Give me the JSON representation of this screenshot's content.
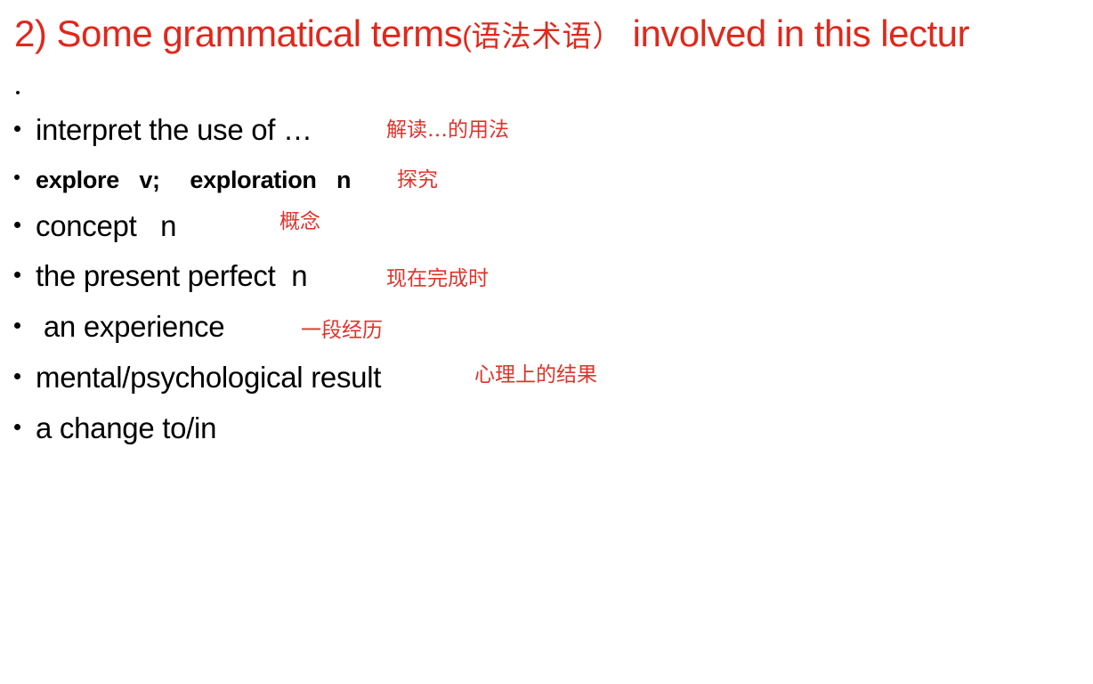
{
  "slide": {
    "title": {
      "prefix": "2) Some grammatical terms",
      "open_paren": "(",
      "chinese": "语法术语",
      "close_paren": "）",
      "suffix": " involved in this lectur"
    },
    "stray_mark": ".",
    "items": [
      {
        "term": "interpret the use of …",
        "gloss": "解读…的用法",
        "bold": false
      },
      {
        "term": "explore  v;   exploration  n",
        "gloss": "探究",
        "bold": true
      },
      {
        "term": "concept   n",
        "gloss": "概念",
        "bold": false
      },
      {
        "term": "the present perfect  n",
        "gloss": "现在完成时",
        "bold": false
      },
      {
        "term": " an experience",
        "gloss": "一段经历",
        "bold": false
      },
      {
        "term": "mental/psychological result",
        "gloss": "心理上的结果",
        "bold": false
      },
      {
        "term": "a change to/in",
        "gloss": "",
        "bold": false
      }
    ]
  },
  "colors": {
    "title": "#e0281c",
    "gloss": "#e0332b",
    "body_text": "#000000",
    "background": "#ffffff"
  }
}
